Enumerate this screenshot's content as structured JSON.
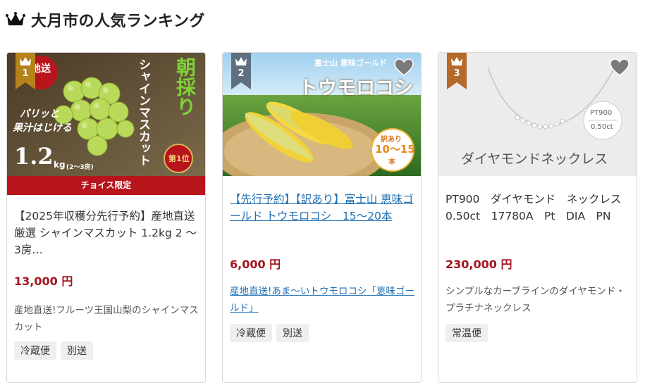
{
  "header": {
    "title": "大月市の人気ランキング",
    "icon": "crown-icon"
  },
  "colors": {
    "accent": "#a3141c",
    "link": "#1f6fb2",
    "rank1": "#b5821b",
    "rank2": "#5f6f7f",
    "rank3": "#b46a2a"
  },
  "cards": [
    {
      "rank": "1",
      "image_text": {
        "vertical_main": "シャインマスカット",
        "harvest": "朝採り",
        "tagline1": "パリッと",
        "tagline2": "果汁はじける",
        "weight": "1.2",
        "weight_unit": "kg",
        "weight_note": "(2～3房)",
        "badge": "第1位",
        "corner": "地送"
      },
      "ribbon": "チョイス限定",
      "name": "【2025年収穫分先行予約】産地直送 厳選 シャインマスカット 1.2kg 2 ～ 3房…",
      "price": "13,000 円",
      "desc": "産地直送!フルーツ王国山梨のシャインマスカット",
      "tags": [
        "冷蔵便",
        "別送"
      ]
    },
    {
      "rank": "2",
      "image_text": {
        "top": "富士山 恵味ゴールド",
        "main": "トウモロコシ",
        "badge1": "訳あり",
        "badge2": "10～15",
        "badge3": "本"
      },
      "name": "【先行予約】【訳あり】富士山 恵味ゴールド トウモロコシ　15～20本",
      "price": "6,000 円",
      "desc": "産地直送!あま～いトウモロコシ「恵味ゴールド」",
      "tags": [
        "冷蔵便",
        "別送"
      ]
    },
    {
      "rank": "3",
      "image_text": {
        "label1": "PT900",
        "label2": "0.50ct",
        "main": "ダイヤモンドネックレス"
      },
      "name": "PT900　ダイヤモンド　ネックレス　0.50ct　17780A　Pt　DIA　PN",
      "price": "230,000 円",
      "desc": "シンプルなカーブラインのダイヤモンド・プラチナネックレス",
      "tags": [
        "常温便"
      ]
    }
  ]
}
